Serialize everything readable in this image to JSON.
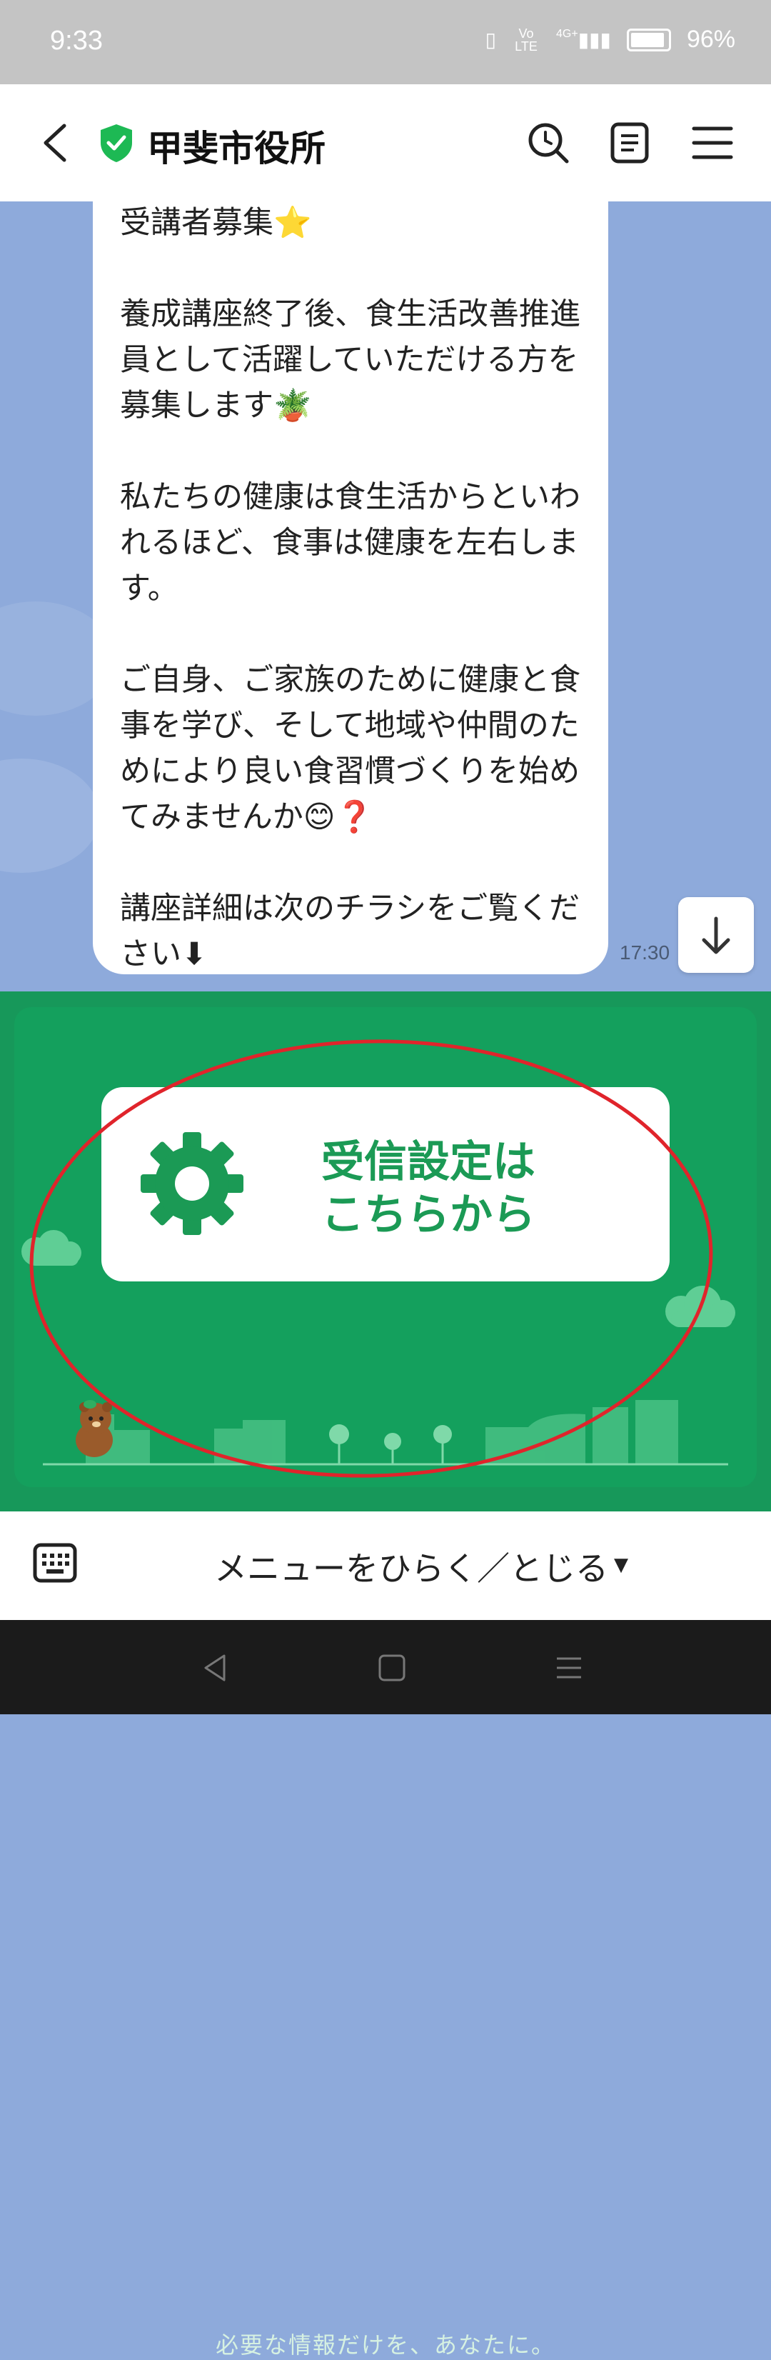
{
  "status_bar": {
    "time": "9:33",
    "network": "4G+",
    "volte": "Vo LTE",
    "battery": "96%"
  },
  "header": {
    "title": "甲斐市役所",
    "verified_color": "#1db954"
  },
  "message": {
    "text": "受講者募集⭐\n\n養成講座終了後、食生活改善推進員として活躍していただける方を募集します🪴\n\n私たちの健康は食生活からといわれるほど、食事は健康を左右します。\n\nご自身、ご家族のために健康と食事を学び、そして地域や仲間のためにより良い食習慣づくりを始めてみませんか😊❓\n\n講座詳細は次のチラシをご覧ください⬇",
    "time": "17:30"
  },
  "rich_menu": {
    "settings_label": "受信設定は\nこちらから",
    "tagline": "必要な情報だけを、あなたに。",
    "accent_color": "#1b9a55",
    "background_color": "#17985a",
    "annotation_color": "#e0242b"
  },
  "bottom_bar": {
    "menu_toggle_label": "メニューをひらく／とじる",
    "menu_toggle_caret": "▼"
  }
}
